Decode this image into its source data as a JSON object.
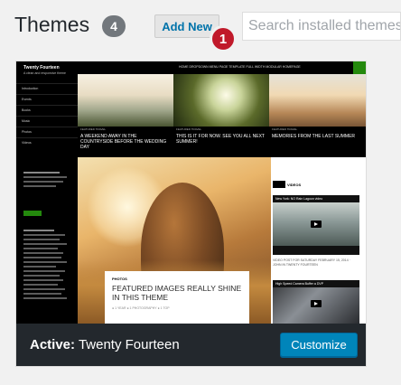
{
  "header": {
    "title": "Themes",
    "count": "4",
    "add_new_label": "Add New",
    "pointer_number": "1",
    "search_placeholder": "Search installed themes..."
  },
  "theme_card": {
    "screenshot": {
      "site_title": "Twenty Fourteen",
      "site_tagline": "A clean and responsive theme",
      "sidebar_menu": [
        "Introduction",
        "Events",
        "Books",
        "Music",
        "Photos",
        "Videos"
      ],
      "top_nav": "HOME   DROPDOWN MENU   PAGE TEMPLATE   FULL WIDTH   MODULAR HOMEPAGE",
      "featured": [
        {
          "kicker": "FEATURED TRAVEL",
          "caption": "A WEEKEND AWAY IN THE COUNTRYSIDE BEFORE THE WEDDING DAY"
        },
        {
          "kicker": "FEATURED TRAVEL",
          "caption": "THIS IS IT FOR NOW. SEE YOU ALL NEXT SUMMER!"
        },
        {
          "kicker": "FEATURED TRAVEL",
          "caption": "MEMORIES FROM THE LAST SUMMER"
        }
      ],
      "post_kicker": "PHOTOS",
      "post_title": "FEATURED IMAGES REALLY SHINE IN THIS THEME",
      "post_meta": "● 1 YEAR  ● 1 PHOTOGRAPHY  ● 1 TOP",
      "widget_title": "VIDEOS",
      "video1_title": "New York: NO Rain Lagoon video",
      "video1_caption": "VIDEO POST FOR SATURDAY FEBRUARY 15, 2014 · JOHN IN TWENTY FOURTEEN",
      "video2_title": "High Speed Camera Buffer a DVP"
    },
    "active_prefix": "Active:",
    "active_theme_name": "Twenty Fourteen",
    "customize_label": "Customize"
  },
  "colors": {
    "accent": "#0085ba",
    "footer_bg": "#23282d",
    "pointer": "#c0192a",
    "green": "#24890d"
  }
}
